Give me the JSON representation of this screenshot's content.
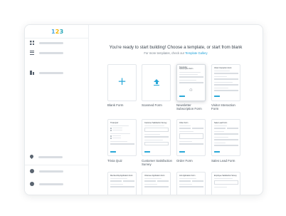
{
  "app": {
    "logo_text": [
      "1",
      "2",
      "3"
    ]
  },
  "main": {
    "heading": "You're ready to start building! Choose a template, or start from blank",
    "subheading_prefix": "For more templates, check our ",
    "subheading_link": "Template Gallery"
  },
  "templates": [
    {
      "label": "Blank Form",
      "preview": "plus-icon"
    },
    {
      "label": "Scanned Form",
      "preview": "upload-icon"
    },
    {
      "label": "Newsletter Subscription Form",
      "preview_title": "Newsletter Subscription Form"
    },
    {
      "label": "Visitor Interaction Form",
      "preview_title": "Visitor Interaction Form"
    },
    {
      "label": "Trivia Quiz",
      "preview_title": "Trivia Quiz"
    },
    {
      "label": "Customer Satisfaction Survey",
      "preview_title": "Customer Satisfaction Survey"
    },
    {
      "label": "Order Form",
      "preview_title": "Order Form"
    },
    {
      "label": "Sales Lead Form",
      "preview_title": "Sales Lead Form"
    },
    {
      "label": "",
      "preview_title": "Membership Application Form"
    },
    {
      "label": "",
      "preview_title": "Volunteer Application Form"
    },
    {
      "label": "",
      "preview_title": "Job Application Form"
    },
    {
      "label": "",
      "preview_title": "Employee Satisfaction Survey"
    }
  ],
  "colors": {
    "accent": "#2aa8d8",
    "logo_1": "#4aa8e0",
    "logo_2": "#f5b400",
    "logo_3": "#2aa8b8"
  }
}
